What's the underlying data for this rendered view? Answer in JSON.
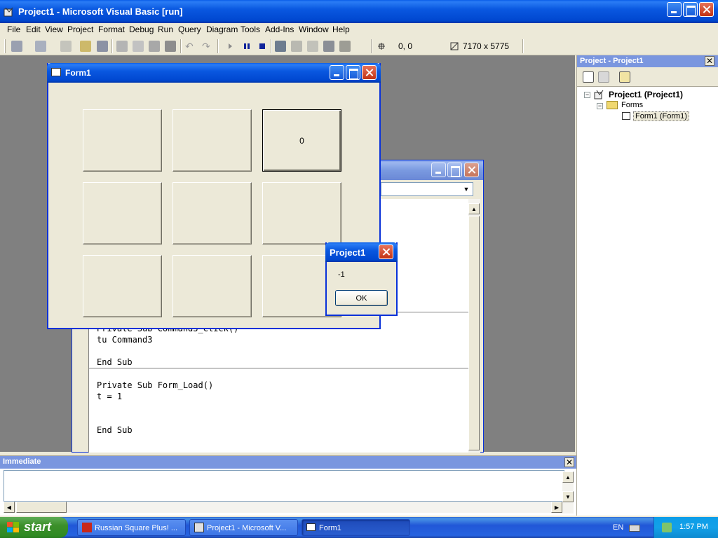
{
  "main_window": {
    "title": "Project1 - Microsoft Visual Basic [run]"
  },
  "menu": [
    "File",
    "Edit",
    "View",
    "Project",
    "Format",
    "Debug",
    "Run",
    "Query",
    "Diagram",
    "Tools",
    "Add-Ins",
    "Window",
    "Help"
  ],
  "toolbar": {
    "position": "0, 0",
    "size": "7170 x 5775"
  },
  "form1": {
    "title": "Form1",
    "buttons": [
      "",
      "",
      "0",
      "",
      "",
      "",
      "",
      "",
      ""
    ]
  },
  "code_window": {
    "lines_a": "Private Sub Command3_Click()\ntu Command3\n\nEnd Sub",
    "lines_b": "Private Sub Form_Load()\nt = 1\n\n\nEnd Sub"
  },
  "msgbox": {
    "title": "Project1",
    "message": "-1",
    "ok_label": "OK"
  },
  "project_explorer": {
    "title": "Project - Project1",
    "root": "Project1 (Project1)",
    "folder": "Forms",
    "item": "Form1 (Form1)"
  },
  "immediate": {
    "title": "Immediate"
  },
  "taskbar": {
    "start_label": "start",
    "tasks": [
      "Russian Square Plus! ...",
      "Project1 - Microsoft V...",
      "Form1"
    ],
    "lang": "EN",
    "clock": "1:57 PM"
  },
  "colors": {
    "xp_blue": "#0a58e0",
    "taskbar": "#2157d7",
    "start_green": "#3c8f2a",
    "mdi_bg": "#808080"
  }
}
